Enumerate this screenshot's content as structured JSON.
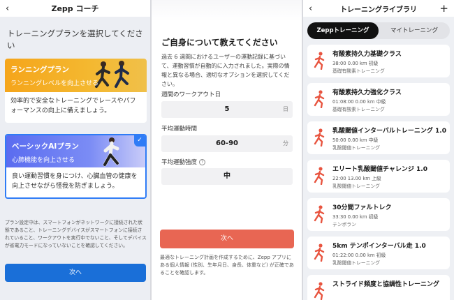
{
  "screen1": {
    "header_title": "Zepp コーチ",
    "heading": "トレーニングプランを選択してください",
    "plans": [
      {
        "name": "ランニングプラン",
        "subtitle": "ランニングレベルを向上させる",
        "description": "効率的で安全なトレーニングでレースやパフォーマンスの向上に備えましょう。"
      },
      {
        "name": "ベーシックAIプラン",
        "subtitle": "心肺機能を向上させる",
        "description": "良い運動習慣を身につけ、心臓血管の健康を向上させながら怪我を防ぎましょう。"
      }
    ],
    "note": "プラン設定中は、スマートフォンがネットワークに接続された状態であること、トレーニングデバイスがスマートフォンに接続されていること、ワークアウトを実行中でないこと、そしてデバイスが省電力モードになっていないことを確認してください。",
    "next_button": "次へ"
  },
  "screen2": {
    "title": "ご自身について教えてください",
    "description": "過去 6 週間におけるユーザーの運動記録に基づいて、運動習慣が自動的に入力されました。実際の情報と異なる場合、適切なオプションを選択してください。",
    "fields": [
      {
        "label": "週間のワークアウト日",
        "value": "5",
        "unit": "日"
      },
      {
        "label": "平均運動時間",
        "value": "60-90",
        "unit": "分"
      },
      {
        "label": "平均運動強度",
        "value": "中",
        "unit": ""
      }
    ],
    "next_button": "次へ",
    "note": "最適なトレーニング計画を作成するために、Zepp アプリにある個人情報 (性別、生年月日、身長、体重など) が正確であることを確認します。"
  },
  "screen3": {
    "header_title": "トレーニングライブラリ",
    "tabs": [
      "Zeppトレーニング",
      "マイトレーニング"
    ],
    "courses": [
      {
        "name": "有酸素持久力基礎クラス",
        "meta": "38:00 0.00 km 初級",
        "type": "基礎有酸素トレーニング"
      },
      {
        "name": "有酸素持久力強化クラス",
        "meta": "01:08:00 0.00 km 中級",
        "type": "基礎有酸素トレーニング"
      },
      {
        "name": "乳酸閾値インターバルトレーニング 1.0",
        "meta": "50:00 0.00 km 中級",
        "type": "乳酸閾値トレーニング"
      },
      {
        "name": "エリート乳酸閾値チャレンジ 1.0",
        "meta": "22:00 13.00 km 上級",
        "type": "乳酸閾値トレーニング"
      },
      {
        "name": "30分間ファルトレク",
        "meta": "33:30 0.00 km 初級",
        "type": "テンポラン"
      },
      {
        "name": "5km テンポインターバル走 1.0",
        "meta": "01:22:00 0.00 km 初級",
        "type": "乳酸閾値トレーニング"
      },
      {
        "name": "ストライド頻度と協調性トレーニング",
        "meta": "",
        "type": ""
      }
    ],
    "accent": "#e8543f"
  }
}
